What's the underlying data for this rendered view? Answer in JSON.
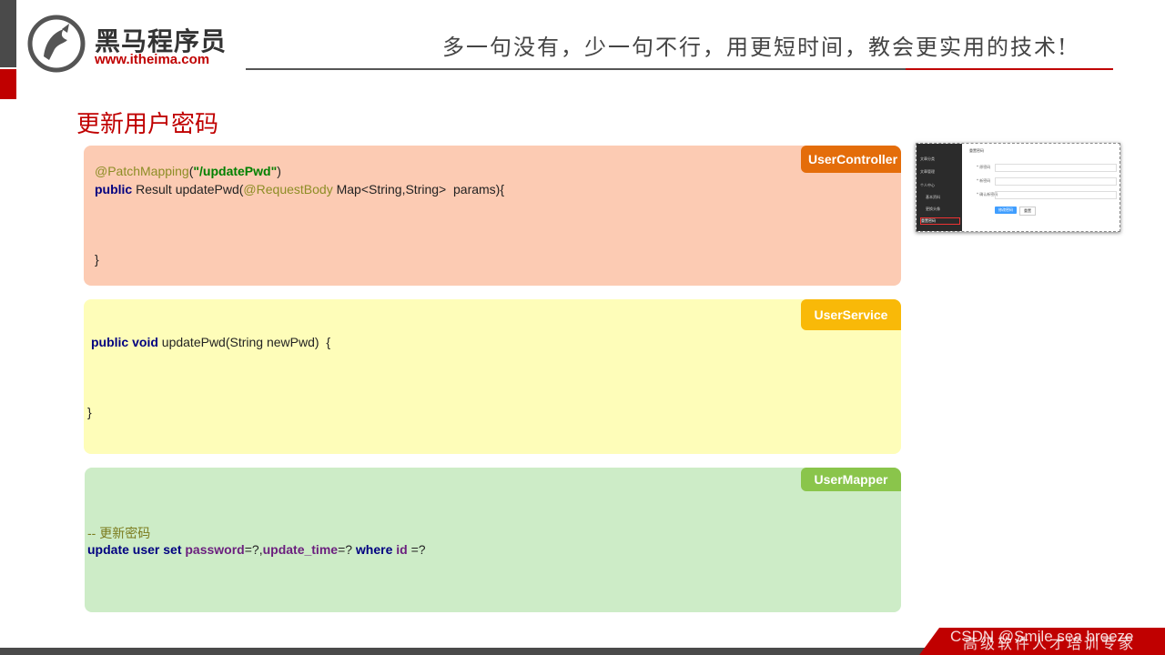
{
  "header": {
    "logo_cn": "黑马程序员",
    "logo_url": "www.itheima.com",
    "slogan": "多一句没有，少一句不行，用更短时间，教会更实用的技术!"
  },
  "title": "更新用户密码",
  "controller": {
    "tag": "UserController",
    "anno": "@PatchMapping",
    "paren_open": "(",
    "path": "\"/updatePwd\"",
    "paren_close": ")",
    "kw_public": "public",
    "sig_a": " Result updatePwd(",
    "anno2": "@RequestBody",
    "sig_b": " Map<String,String>  params){",
    "close": "}"
  },
  "service": {
    "tag": "UserService",
    "kw": "public void",
    "sig": " updatePwd(String newPwd)  {",
    "close": "}"
  },
  "mapper": {
    "tag": "UserMapper",
    "comment": "-- 更新密码",
    "kw1": "update user set ",
    "col1": "password",
    "t1": "=?,",
    "col2": "update_time",
    "t2": "=? ",
    "kw2": "where ",
    "col3": "id",
    "t3": " =?"
  },
  "thumbnail": {
    "menu": [
      "文章分类",
      "文章管理",
      "个人中心",
      "基本资料",
      "更换头像",
      "重置密码"
    ],
    "page_title": "重置密码",
    "labels": [
      "* 原密码",
      "* 新密码",
      "* 确认新密码"
    ],
    "btn_primary": "修改密码",
    "btn_reset": "重置"
  },
  "footer": {
    "text": "高级软件人才培训专家",
    "watermark": "CSDN @Smile sea breeze"
  },
  "colors": {
    "accent_red": "#c00000",
    "controller_bg": "#fccbb3",
    "service_bg": "#fefdb9",
    "mapper_bg": "#cdecc7",
    "controller_tag": "#e46d0a",
    "service_tag": "#f9b908",
    "mapper_tag": "#8ac54b"
  }
}
